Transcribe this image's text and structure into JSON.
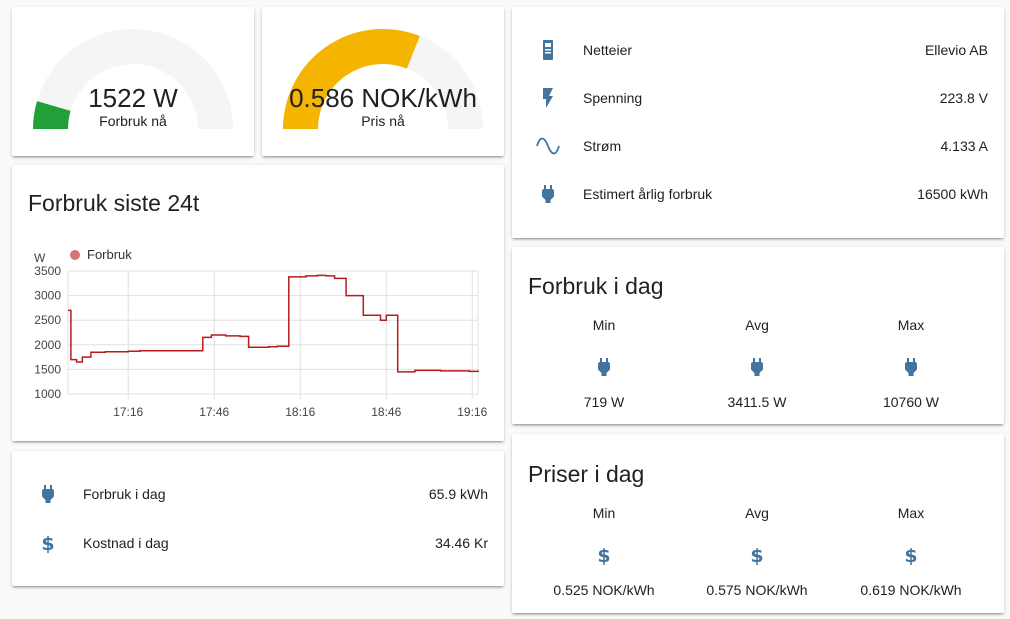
{
  "gauges": [
    {
      "value": "1522 W",
      "label": "Forbruk nå",
      "fraction": 0.09,
      "color": "#21a03a"
    },
    {
      "value": "0.586 NOK/kWh",
      "label": "Pris nå",
      "fraction": 0.62,
      "color": "#f4b400"
    }
  ],
  "chart_card": {
    "title": "Forbruk siste 24t"
  },
  "chart_data": {
    "type": "line",
    "ylabel": "W",
    "ylim": [
      1000,
      3500
    ],
    "yticks": [
      "1000",
      "1500",
      "2000",
      "2500",
      "3000",
      "3500"
    ],
    "xticks": [
      "17:16",
      "17:46",
      "18:16",
      "18:46",
      "19:16"
    ],
    "series": [
      {
        "name": "Forbruk",
        "color": "#b71c1c",
        "x": [
          "16:55",
          "16:56",
          "16:58",
          "17:00",
          "17:03",
          "17:08",
          "17:16",
          "17:20",
          "17:30",
          "17:40",
          "17:42",
          "17:45",
          "17:47",
          "17:50",
          "17:55",
          "17:58",
          "18:00",
          "18:05",
          "18:08",
          "18:12",
          "18:18",
          "18:22",
          "18:25",
          "18:28",
          "18:32",
          "18:38",
          "18:44",
          "18:46",
          "18:50",
          "18:56",
          "19:05",
          "19:15",
          "19:18"
        ],
        "values": [
          2700,
          1700,
          1650,
          1750,
          1850,
          1860,
          1870,
          1880,
          1880,
          1880,
          2150,
          2200,
          2200,
          2180,
          2170,
          1950,
          1950,
          1960,
          1970,
          3380,
          3400,
          3410,
          3400,
          3350,
          3000,
          2600,
          2500,
          2600,
          1450,
          1480,
          1470,
          1460,
          1480
        ]
      }
    ]
  },
  "usage_card": {
    "rows": [
      {
        "icon": "plug-icon",
        "name": "Forbruk i dag",
        "value": "65.9 kWh"
      },
      {
        "icon": "dollar-icon",
        "name": "Kostnad i dag",
        "value": "34.46 Kr"
      }
    ]
  },
  "meter_card": {
    "rows": [
      {
        "icon": "meter-icon",
        "name": "Netteier",
        "value": "Ellevio AB"
      },
      {
        "icon": "flash-icon",
        "name": "Spenning",
        "value": "223.8 V"
      },
      {
        "icon": "sine-wave-icon",
        "name": "Strøm",
        "value": "4.133 A"
      },
      {
        "icon": "plug-icon",
        "name": "Estimert årlig forbruk",
        "value": "16500 kWh"
      }
    ]
  },
  "consumption_today": {
    "title": "Forbruk i dag",
    "stats": [
      {
        "label": "Min",
        "icon": "plug-icon",
        "value": "719 W"
      },
      {
        "label": "Avg",
        "icon": "plug-icon",
        "value": "3411.5 W"
      },
      {
        "label": "Max",
        "icon": "plug-icon",
        "value": "10760 W"
      }
    ]
  },
  "prices_today": {
    "title": "Priser i dag",
    "stats": [
      {
        "label": "Min",
        "icon": "dollar-icon",
        "value": "0.525 NOK/kWh"
      },
      {
        "label": "Avg",
        "icon": "dollar-icon",
        "value": "0.575 NOK/kWh"
      },
      {
        "label": "Max",
        "icon": "dollar-icon",
        "value": "0.619 NOK/kWh"
      }
    ]
  },
  "colors": {
    "icon": "#44739e",
    "gauge_track": "#f5f5f5"
  }
}
